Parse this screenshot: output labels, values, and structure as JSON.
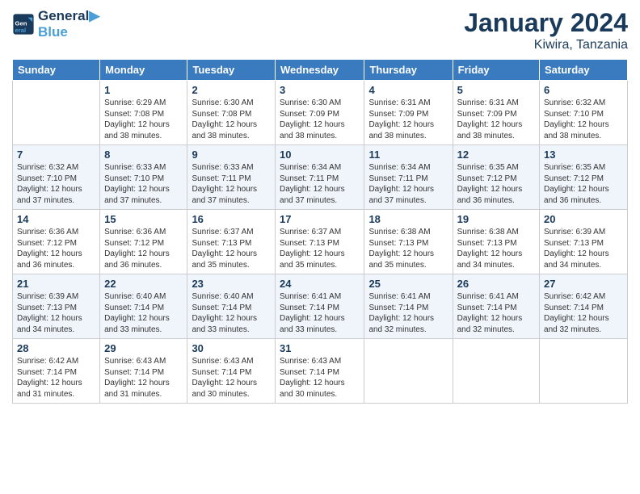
{
  "header": {
    "logo_line1": "General",
    "logo_line2": "Blue",
    "month": "January 2024",
    "location": "Kiwira, Tanzania"
  },
  "weekdays": [
    "Sunday",
    "Monday",
    "Tuesday",
    "Wednesday",
    "Thursday",
    "Friday",
    "Saturday"
  ],
  "weeks": [
    [
      {
        "day": "",
        "info": ""
      },
      {
        "day": "1",
        "info": "Sunrise: 6:29 AM\nSunset: 7:08 PM\nDaylight: 12 hours\nand 38 minutes."
      },
      {
        "day": "2",
        "info": "Sunrise: 6:30 AM\nSunset: 7:08 PM\nDaylight: 12 hours\nand 38 minutes."
      },
      {
        "day": "3",
        "info": "Sunrise: 6:30 AM\nSunset: 7:09 PM\nDaylight: 12 hours\nand 38 minutes."
      },
      {
        "day": "4",
        "info": "Sunrise: 6:31 AM\nSunset: 7:09 PM\nDaylight: 12 hours\nand 38 minutes."
      },
      {
        "day": "5",
        "info": "Sunrise: 6:31 AM\nSunset: 7:09 PM\nDaylight: 12 hours\nand 38 minutes."
      },
      {
        "day": "6",
        "info": "Sunrise: 6:32 AM\nSunset: 7:10 PM\nDaylight: 12 hours\nand 38 minutes."
      }
    ],
    [
      {
        "day": "7",
        "info": "Sunrise: 6:32 AM\nSunset: 7:10 PM\nDaylight: 12 hours\nand 37 minutes."
      },
      {
        "day": "8",
        "info": "Sunrise: 6:33 AM\nSunset: 7:10 PM\nDaylight: 12 hours\nand 37 minutes."
      },
      {
        "day": "9",
        "info": "Sunrise: 6:33 AM\nSunset: 7:11 PM\nDaylight: 12 hours\nand 37 minutes."
      },
      {
        "day": "10",
        "info": "Sunrise: 6:34 AM\nSunset: 7:11 PM\nDaylight: 12 hours\nand 37 minutes."
      },
      {
        "day": "11",
        "info": "Sunrise: 6:34 AM\nSunset: 7:11 PM\nDaylight: 12 hours\nand 37 minutes."
      },
      {
        "day": "12",
        "info": "Sunrise: 6:35 AM\nSunset: 7:12 PM\nDaylight: 12 hours\nand 36 minutes."
      },
      {
        "day": "13",
        "info": "Sunrise: 6:35 AM\nSunset: 7:12 PM\nDaylight: 12 hours\nand 36 minutes."
      }
    ],
    [
      {
        "day": "14",
        "info": "Sunrise: 6:36 AM\nSunset: 7:12 PM\nDaylight: 12 hours\nand 36 minutes."
      },
      {
        "day": "15",
        "info": "Sunrise: 6:36 AM\nSunset: 7:12 PM\nDaylight: 12 hours\nand 36 minutes."
      },
      {
        "day": "16",
        "info": "Sunrise: 6:37 AM\nSunset: 7:13 PM\nDaylight: 12 hours\nand 35 minutes."
      },
      {
        "day": "17",
        "info": "Sunrise: 6:37 AM\nSunset: 7:13 PM\nDaylight: 12 hours\nand 35 minutes."
      },
      {
        "day": "18",
        "info": "Sunrise: 6:38 AM\nSunset: 7:13 PM\nDaylight: 12 hours\nand 35 minutes."
      },
      {
        "day": "19",
        "info": "Sunrise: 6:38 AM\nSunset: 7:13 PM\nDaylight: 12 hours\nand 34 minutes."
      },
      {
        "day": "20",
        "info": "Sunrise: 6:39 AM\nSunset: 7:13 PM\nDaylight: 12 hours\nand 34 minutes."
      }
    ],
    [
      {
        "day": "21",
        "info": "Sunrise: 6:39 AM\nSunset: 7:13 PM\nDaylight: 12 hours\nand 34 minutes."
      },
      {
        "day": "22",
        "info": "Sunrise: 6:40 AM\nSunset: 7:14 PM\nDaylight: 12 hours\nand 33 minutes."
      },
      {
        "day": "23",
        "info": "Sunrise: 6:40 AM\nSunset: 7:14 PM\nDaylight: 12 hours\nand 33 minutes."
      },
      {
        "day": "24",
        "info": "Sunrise: 6:41 AM\nSunset: 7:14 PM\nDaylight: 12 hours\nand 33 minutes."
      },
      {
        "day": "25",
        "info": "Sunrise: 6:41 AM\nSunset: 7:14 PM\nDaylight: 12 hours\nand 32 minutes."
      },
      {
        "day": "26",
        "info": "Sunrise: 6:41 AM\nSunset: 7:14 PM\nDaylight: 12 hours\nand 32 minutes."
      },
      {
        "day": "27",
        "info": "Sunrise: 6:42 AM\nSunset: 7:14 PM\nDaylight: 12 hours\nand 32 minutes."
      }
    ],
    [
      {
        "day": "28",
        "info": "Sunrise: 6:42 AM\nSunset: 7:14 PM\nDaylight: 12 hours\nand 31 minutes."
      },
      {
        "day": "29",
        "info": "Sunrise: 6:43 AM\nSunset: 7:14 PM\nDaylight: 12 hours\nand 31 minutes."
      },
      {
        "day": "30",
        "info": "Sunrise: 6:43 AM\nSunset: 7:14 PM\nDaylight: 12 hours\nand 30 minutes."
      },
      {
        "day": "31",
        "info": "Sunrise: 6:43 AM\nSunset: 7:14 PM\nDaylight: 12 hours\nand 30 minutes."
      },
      {
        "day": "",
        "info": ""
      },
      {
        "day": "",
        "info": ""
      },
      {
        "day": "",
        "info": ""
      }
    ]
  ]
}
